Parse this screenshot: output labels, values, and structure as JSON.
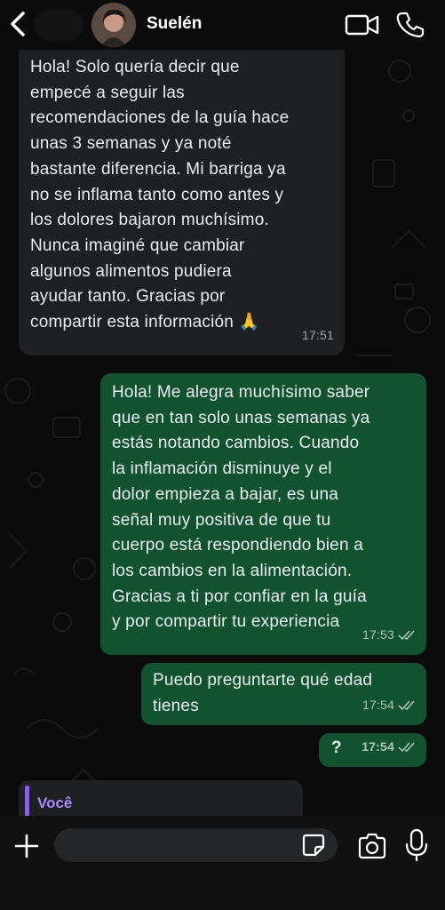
{
  "header": {
    "contact_name": "Suelén",
    "icons": [
      "back-chevron-icon",
      "video-camera-icon",
      "phone-icon"
    ]
  },
  "messages": [
    {
      "direction": "incoming",
      "text": "Hola! Solo quería decir que\nempecé a seguir las\nrecomendaciones de la guía hace\nunas 3 semanas y ya noté\nbastante diferencia. Mi barriga ya\nno se inflama tanto como antes y\nlos dolores bajaron muchísimo.\nNunca imaginé que cambiar\nalgunos alimentos pudiera\nayudar tanto. Gracias por\ncompartir esta información 🙏",
      "time": "17:51"
    },
    {
      "direction": "outgoing",
      "text": "Hola! Me alegra muchísimo saber\nque en tan solo unas semanas ya\nestás notando cambios. Cuando\nla inflamación disminuye y el\ndolor empieza a bajar, es una\nseñal muy positiva de que tu\ncuerpo está respondiendo bien a\nlos cambios en la alimentación.\nGracias a ti por confiar en la guía\ny por compartir tu experiencia",
      "time": "17:53",
      "status": "read"
    },
    {
      "direction": "outgoing",
      "text": "Puedo preguntarte qué edad\ntienes",
      "time": "17:54",
      "status": "read"
    },
    {
      "direction": "outgoing",
      "text": "?",
      "time": "17:54",
      "status": "read"
    }
  ],
  "reply_preview": {
    "author": "Você"
  },
  "composer": {
    "placeholder": "",
    "icons": [
      "plus-icon",
      "sticker-icon",
      "camera-icon",
      "microphone-icon"
    ]
  },
  "colors": {
    "background": "#0b0b0b",
    "incoming_bubble": "#1f2022",
    "outgoing_bubble": "#12532f",
    "reply_accent": "#8b5cf6"
  }
}
